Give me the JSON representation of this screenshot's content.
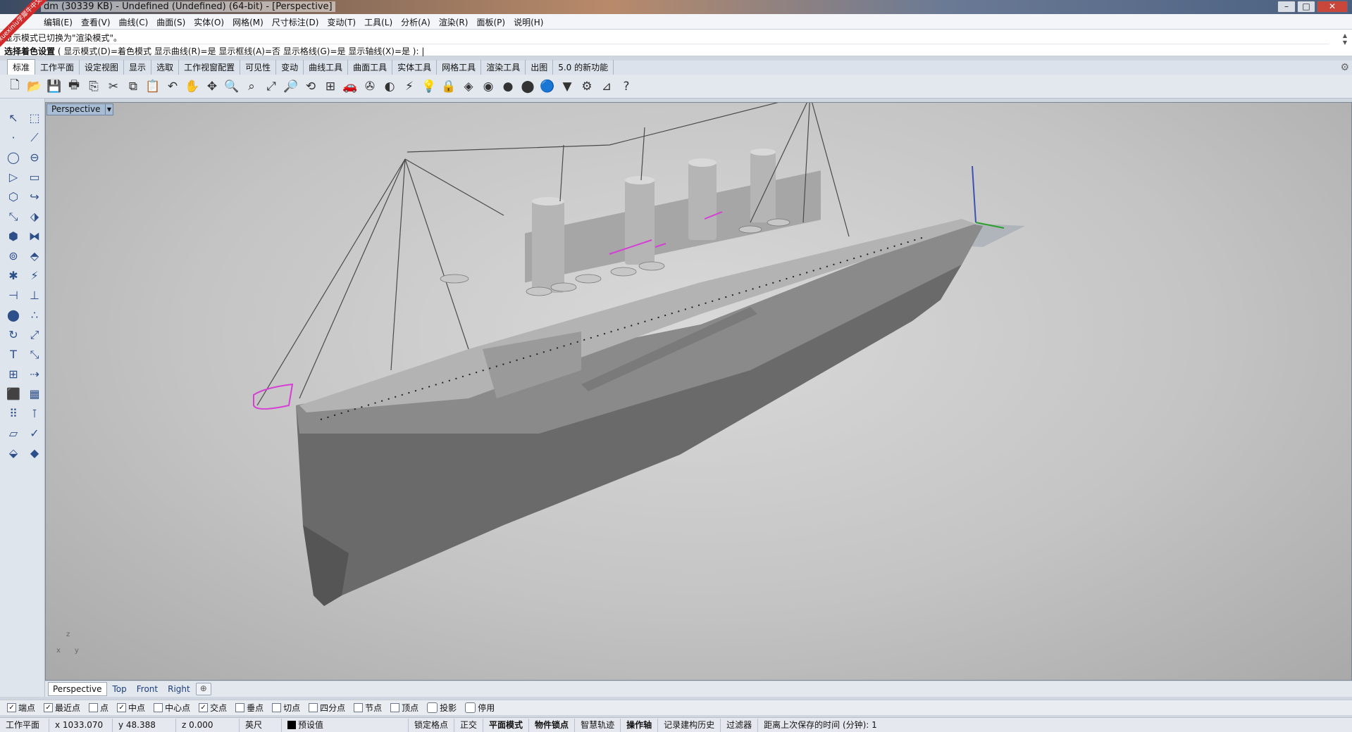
{
  "titlebar": {
    "title": "dm (30339 KB) - Undefined (Undefined) (64-bit) - [Perspective]",
    "badge": "xuexiniu学犀牛中文网",
    "minimize": "–",
    "maximize": "□",
    "close": "✕"
  },
  "menu": [
    "编辑(E)",
    "查看(V)",
    "曲线(C)",
    "曲面(S)",
    "实体(O)",
    "网格(M)",
    "尺寸标注(D)",
    "变动(T)",
    "工具(L)",
    "分析(A)",
    "渲染(R)",
    "面板(P)",
    "说明(H)"
  ],
  "command": {
    "history": "显示模式已切换为\"渲染模式\"。",
    "prompt_label": "选择着色设置",
    "prompt_options": "( 显示模式(D)=着色模式  显示曲线(R)=是  显示框线(A)=否  显示格线(G)=是  显示轴线(X)=是 ): |"
  },
  "tabs": [
    "标准",
    "工作平面",
    "设定视图",
    "显示",
    "选取",
    "工作视窗配置",
    "可见性",
    "变动",
    "曲线工具",
    "曲面工具",
    "实体工具",
    "网格工具",
    "渲染工具",
    "出图",
    "5.0 的新功能"
  ],
  "toolbar_icons": [
    {
      "name": "new-file-icon",
      "glyph": "🗋"
    },
    {
      "name": "open-file-icon",
      "glyph": "📂"
    },
    {
      "name": "save-icon",
      "glyph": "💾"
    },
    {
      "name": "print-icon",
      "glyph": "🖶"
    },
    {
      "name": "import-icon",
      "glyph": "⎘"
    },
    {
      "name": "cut-icon",
      "glyph": "✂"
    },
    {
      "name": "copy-icon",
      "glyph": "⧉"
    },
    {
      "name": "paste-icon",
      "glyph": "📋"
    },
    {
      "name": "undo-icon",
      "glyph": "↶"
    },
    {
      "name": "pan-icon",
      "glyph": "✋"
    },
    {
      "name": "rotate-view-icon",
      "glyph": "✥"
    },
    {
      "name": "zoom-icon",
      "glyph": "🔍"
    },
    {
      "name": "zoom-window-icon",
      "glyph": "⌕"
    },
    {
      "name": "zoom-extents-icon",
      "glyph": "⤢"
    },
    {
      "name": "zoom-selected-icon",
      "glyph": "🔎"
    },
    {
      "name": "undo-view-icon",
      "glyph": "⟲"
    },
    {
      "name": "four-viewports-icon",
      "glyph": "⊞"
    },
    {
      "name": "car-icon",
      "glyph": "🚗"
    },
    {
      "name": "camera-icon",
      "glyph": "✇"
    },
    {
      "name": "hide-icon",
      "glyph": "◐"
    },
    {
      "name": "select-icon",
      "glyph": "⚡"
    },
    {
      "name": "light-icon",
      "glyph": "💡"
    },
    {
      "name": "lock-icon",
      "glyph": "🔒"
    },
    {
      "name": "layer-icon",
      "glyph": "◈"
    },
    {
      "name": "color-wheel-icon",
      "glyph": "◉"
    },
    {
      "name": "render-sphere-icon",
      "glyph": "●"
    },
    {
      "name": "material-sphere-icon",
      "glyph": "⬤"
    },
    {
      "name": "environment-sphere-icon",
      "glyph": "🔵"
    },
    {
      "name": "spotlight-icon",
      "glyph": "▼"
    },
    {
      "name": "settings-gear-icon",
      "glyph": "⚙"
    },
    {
      "name": "analyze-icon",
      "glyph": "⊿"
    },
    {
      "name": "help-icon",
      "glyph": "?"
    }
  ],
  "left_tools": [
    "select-arrow-icon",
    "select-points-icon",
    "point-icon",
    "polyline-icon",
    "circle-icon",
    "ellipse-icon",
    "arc-icon",
    "rectangle-icon",
    "polygon-icon",
    "curve-fillet-icon",
    "surface-edit-icon",
    "surface-tool-icon",
    "box-icon",
    "boolean-union-icon",
    "cylinder-icon",
    "extrude-icon",
    "explode-icon",
    "split-icon",
    "trim-icon",
    "join-icon",
    "group-icon",
    "array-icon",
    "rotate-icon",
    "scale-icon",
    "text-icon",
    "dimension-icon",
    "block-icon",
    "transform-icon",
    "solid-box-icon",
    "mesh-icon",
    "grid-array-icon",
    "pipe-icon",
    "section-icon",
    "check-icon",
    "render-icon",
    "material-icon"
  ],
  "left_tool_glyphs": [
    "↖",
    "⬚",
    "·",
    "⟋",
    "◯",
    "⊖",
    "▷",
    "▭",
    "⬡",
    "↪",
    "⤡",
    "⬗",
    "⬢",
    "⧓",
    "⊚",
    "⬘",
    "✱",
    "⚡",
    "⊣",
    "⊥",
    "⬤",
    "∴",
    "↻",
    "⤢",
    "T",
    "⤡",
    "⊞",
    "⇢",
    "⬛",
    "▦",
    "⠿",
    "⊺",
    "▱",
    "✓",
    "⬙",
    "◆"
  ],
  "viewport": {
    "label": "Perspective",
    "axes": {
      "z": "z",
      "x": "x",
      "y": "y"
    }
  },
  "viewport_tabs": [
    "Perspective",
    "Top",
    "Front",
    "Right"
  ],
  "osnap": [
    {
      "label": "端点",
      "checked": true
    },
    {
      "label": "最近点",
      "checked": true
    },
    {
      "label": "点",
      "checked": false
    },
    {
      "label": "中点",
      "checked": true
    },
    {
      "label": "中心点",
      "checked": false
    },
    {
      "label": "交点",
      "checked": true
    },
    {
      "label": "垂点",
      "checked": false
    },
    {
      "label": "切点",
      "checked": false
    },
    {
      "label": "四分点",
      "checked": false
    },
    {
      "label": "节点",
      "checked": false
    },
    {
      "label": "顶点",
      "checked": false
    },
    {
      "label": "投影",
      "checked": false,
      "big": true
    },
    {
      "label": "停用",
      "checked": false,
      "big": true
    }
  ],
  "status": {
    "cplane": "工作平面",
    "x": "x 1033.070",
    "y": "y 48.388",
    "z": "z 0.000",
    "units": "英尺",
    "layer": "预设值",
    "grid_snap": "锁定格点",
    "ortho": "正交",
    "planar": "平面模式",
    "osnap": "物件锁点",
    "smarttrack": "智慧轨迹",
    "gumball": "操作轴",
    "history": "记录建构历史",
    "filter": "过滤器",
    "autosave": "距离上次保存的时间 (分钟): 1"
  },
  "colors": {
    "hull": "#6b6b6b",
    "highlight": "#d63fd6",
    "viewport_bg": "#c4c4c4"
  }
}
